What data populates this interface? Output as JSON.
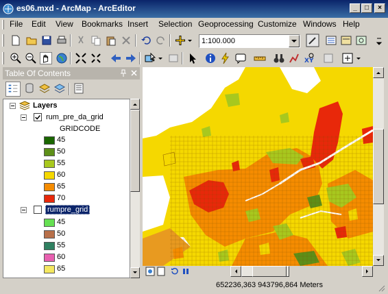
{
  "window": {
    "title": "es06.mxd - ArcMap - ArcEditor"
  },
  "menu": [
    "File",
    "Edit",
    "View",
    "Bookmarks",
    "Insert",
    "Selection",
    "Geoprocessing",
    "Customize",
    "Windows",
    "Help"
  ],
  "toolbar": {
    "scale_value": "1:100.000"
  },
  "toc": {
    "title": "Table Of Contents",
    "root": "Layers",
    "layer1": {
      "name": "rum_pre_da_grid",
      "field": "GRIDCODE",
      "classes": [
        {
          "label": "45",
          "color": "#1a6600"
        },
        {
          "label": "50",
          "color": "#5d8f18"
        },
        {
          "label": "55",
          "color": "#a8c81e"
        },
        {
          "label": "60",
          "color": "#f5d800"
        },
        {
          "label": "65",
          "color": "#f58c00"
        },
        {
          "label": "70",
          "color": "#e8280a"
        }
      ]
    },
    "layer2": {
      "name": "rumpre_grid",
      "classes": [
        {
          "label": "45",
          "color": "#66e052"
        },
        {
          "label": "50",
          "color": "#b8704a"
        },
        {
          "label": "55",
          "color": "#2f8060"
        },
        {
          "label": "60",
          "color": "#e860b0"
        },
        {
          "label": "65",
          "color": "#f5e860"
        }
      ]
    }
  },
  "status": {
    "coordinates": "652236,363  943796,864 Meters"
  }
}
